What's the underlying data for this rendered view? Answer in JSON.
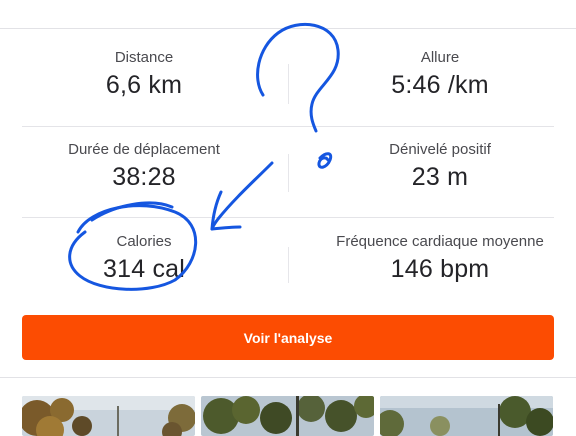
{
  "stats": {
    "distance": {
      "label": "Distance",
      "value": "6,6 km"
    },
    "pace": {
      "label": "Allure",
      "value": "5:46 /km"
    },
    "moving_time": {
      "label": "Durée de déplacement",
      "value": "38:28"
    },
    "elevation": {
      "label": "Dénivelé positif",
      "value": "23 m"
    },
    "calories": {
      "label": "Calories",
      "value": "314 cal"
    },
    "heart_rate": {
      "label": "Fréquence cardiaque moyenne",
      "value": "146 bpm"
    }
  },
  "actions": {
    "analysis_button": "Voir l'analyse"
  },
  "colors": {
    "accent": "#fc4c02",
    "annotation": "#1556e0"
  }
}
